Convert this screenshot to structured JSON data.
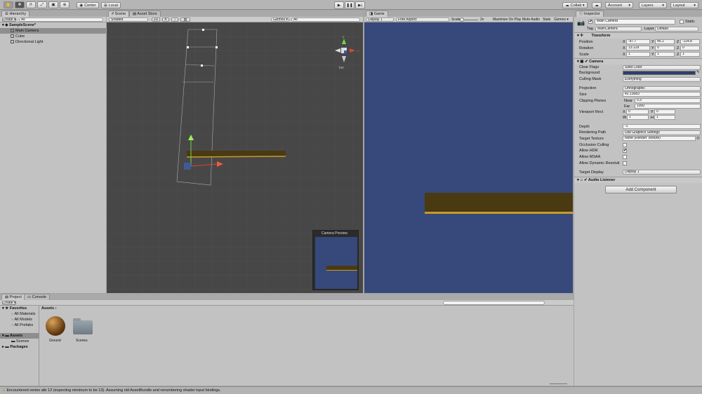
{
  "toolbar": {
    "center": "Center",
    "local": "Local",
    "collab": "Collab ▾",
    "account": "Account",
    "layers": "Layers",
    "layout": "Layout"
  },
  "hierarchy": {
    "tab": "Hierarchy",
    "create": "Create ▾",
    "search": "All",
    "scene": "SampleScene*",
    "items": [
      "Main Camera",
      "Cube",
      "Directional Light"
    ]
  },
  "scene": {
    "tab": "Scene",
    "tab2": "Asset Store",
    "shaded": "Shaded",
    "mode": "2D",
    "gizmos": "Gizmos ▾",
    "search": "All",
    "persp": "Iso",
    "preview_title": "Camera Preview"
  },
  "game": {
    "tab": "Game",
    "display": "Display 1",
    "aspect": "Free Aspect",
    "scale_label": "Scale",
    "scale_val": "2x",
    "maximize": "Maximize On Play",
    "mute": "Mute Audio",
    "stats": "Stats",
    "gizmos": "Gizmos ▾"
  },
  "inspector": {
    "tab": "Inspector",
    "name": "Main Camera",
    "static": "Static",
    "tag_label": "Tag",
    "tag": "MainCamera",
    "layer_label": "Layer",
    "layer": "Default",
    "transform": {
      "title": "Transform",
      "pos": "Position",
      "rot": "Rotation",
      "scale": "Scale",
      "px": "-97.7",
      "py": "46.1",
      "pz": "-114.8",
      "rx": "13.129",
      "ry": "0",
      "rz": "0",
      "sx": "1",
      "sy": "1",
      "sz": "1"
    },
    "camera": {
      "title": "Camera",
      "clear_flags": "Clear Flags",
      "clear_val": "Solid Color",
      "background": "Background",
      "culling": "Culling Mask",
      "culling_val": "Everything",
      "projection": "Projection",
      "projection_val": "Orthographic",
      "size": "Size",
      "size_val": "42.13683",
      "clipping": "Clipping Planes",
      "near": "Near",
      "near_val": "0.3",
      "far": "Far",
      "far_val": "1000",
      "viewport": "Viewport Rect",
      "vx": "0",
      "vy": "0",
      "vw": "1",
      "vh": "1",
      "depth": "Depth",
      "depth_val": "-1",
      "rpath": "Rendering Path",
      "rpath_val": "Use Graphics Settings",
      "target": "Target Texture",
      "target_val": "None (Render Texture)",
      "occlusion": "Occlusion Culling",
      "hdr": "Allow HDR",
      "msaa": "Allow MSAA",
      "dynres": "Allow Dynamic Resoluti",
      "tdisplay": "Target Display",
      "tdisplay_val": "Display 1"
    },
    "audio": "Audio Listener",
    "add": "Add Component"
  },
  "project": {
    "tab": "Project",
    "tab2": "Console",
    "create": "Create ▾",
    "breadcrumb": "Assets",
    "favorites": "Favorites",
    "fav_items": [
      "All Materials",
      "All Models",
      "All Prefabs"
    ],
    "assets": "Assets",
    "asset_children": [
      "Scenes"
    ],
    "packages": "Packages",
    "files": [
      "Ground",
      "Scenes"
    ]
  },
  "status": "Encountered vertex attr 12 (expecting minimum to be 13). Assuming old AssetBundle and renumbering shader input bindings.",
  "colors": {
    "game_bg": "#36497a",
    "scene_bg": "#474747",
    "platform": "#4a3a12",
    "platform_edge": "#c79a30"
  }
}
